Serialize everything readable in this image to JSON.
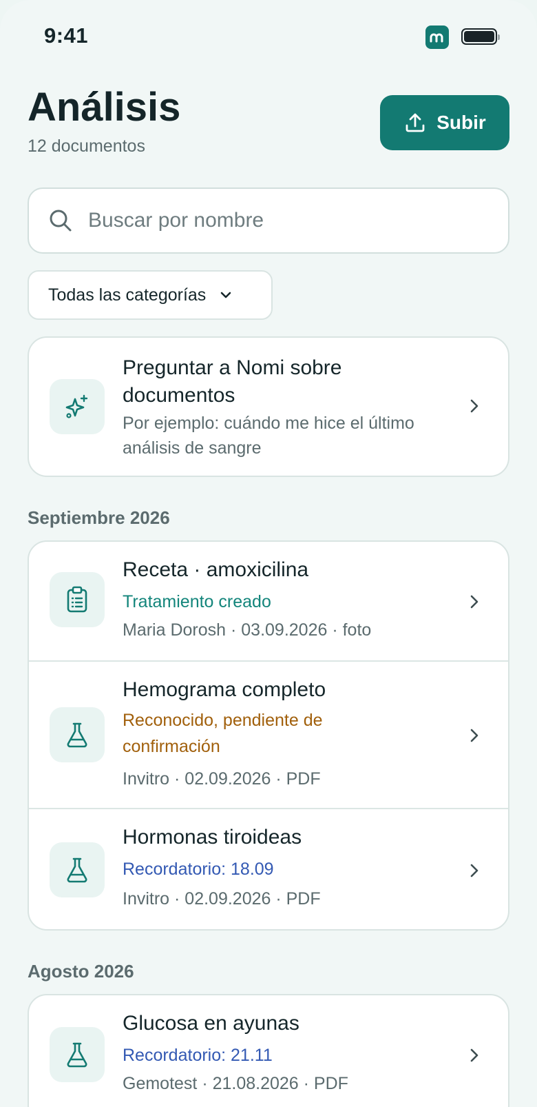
{
  "status_bar": {
    "time": "9:41"
  },
  "header": {
    "title": "Análisis",
    "subtitle": "12 documentos",
    "upload_label": "Subir"
  },
  "search": {
    "placeholder": "Buscar por nombre"
  },
  "filter": {
    "label": "Todas las categorías"
  },
  "ask_card": {
    "title": "Preguntar a Nomi sobre documentos",
    "subtitle": "Por ejemplo: cuándo me hice el último análisis de sangre",
    "icon": "sparkles-icon"
  },
  "sections": [
    {
      "label": "Septiembre 2026",
      "items": [
        {
          "title": "Receta · amoxicilina",
          "status": "Tratamiento creado",
          "status_color": "#13857b",
          "meta": "Maria Dorosh · 03.09.2026 · foto",
          "icon": "clipboard-icon"
        },
        {
          "title": "Hemograma completo",
          "status": "Reconocido, pendiente de confirmación",
          "status_color": "#a1600c",
          "meta": "Invitro · 02.09.2026 · PDF",
          "icon": "flask-icon"
        },
        {
          "title": "Hormonas tiroideas",
          "status": "Recordatorio: 18.09",
          "status_color": "#3359b3",
          "meta": "Invitro · 02.09.2026 · PDF",
          "icon": "flask-icon"
        }
      ]
    },
    {
      "label": "Agosto 2026",
      "items": [
        {
          "title": "Glucosa en ayunas",
          "status": "Recordatorio: 21.11",
          "status_color": "#3359b3",
          "meta": "Gemotest · 21.08.2026 · PDF",
          "icon": "flask-icon"
        }
      ]
    }
  ],
  "colors": {
    "accent": "#137a72",
    "background": "#f1f7f6"
  }
}
